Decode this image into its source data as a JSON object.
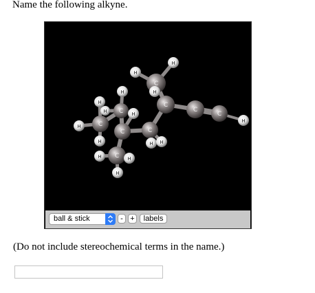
{
  "question": "Name the following alkyne.",
  "viewer": {
    "display_mode": "ball & stick",
    "zoom_out_label": "-",
    "zoom_in_label": "+",
    "labels_label": "labels",
    "carbon_label": "C",
    "hydrogen_label": "H",
    "colors": {
      "background": "#000000",
      "carbon": "#8a8484",
      "hydrogen": "#f2f2f2",
      "toolbar": "#c8c8c8",
      "select_accent": "#2f7cf6"
    }
  },
  "note": "(Do not include stereochemical terms in the name.)",
  "answer": {
    "value": ""
  }
}
